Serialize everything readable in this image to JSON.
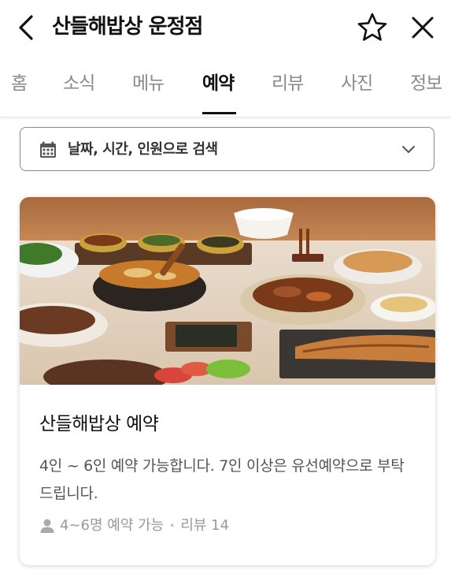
{
  "header": {
    "title": "산들해밥상 운정점"
  },
  "tabs": [
    {
      "label": "홈"
    },
    {
      "label": "소식"
    },
    {
      "label": "메뉴"
    },
    {
      "label": "예약"
    },
    {
      "label": "리뷰"
    },
    {
      "label": "사진"
    },
    {
      "label": "정보"
    }
  ],
  "active_tab": "예약",
  "search": {
    "label": "날짜, 시간, 인원으로 검색"
  },
  "reservation_card": {
    "title": "산들해밥상 예약",
    "description": "4인 ~ 6인 예약 가능합니다. 7인 이상은 유선예약으로 부탁드립니다.",
    "capacity": "4~6명 예약 가능",
    "separator": "•",
    "reviews": "리뷰 14"
  },
  "icons": {
    "back": "chevron-left-icon",
    "favorite": "star-outline-icon",
    "close": "close-icon",
    "calendar": "calendar-icon",
    "dropdown": "chevron-down-icon",
    "person": "person-icon"
  },
  "colors": {
    "text": "#111111",
    "muted": "#8a8a8a",
    "border": "#888888",
    "card_shadow": "#d0d0d0"
  }
}
